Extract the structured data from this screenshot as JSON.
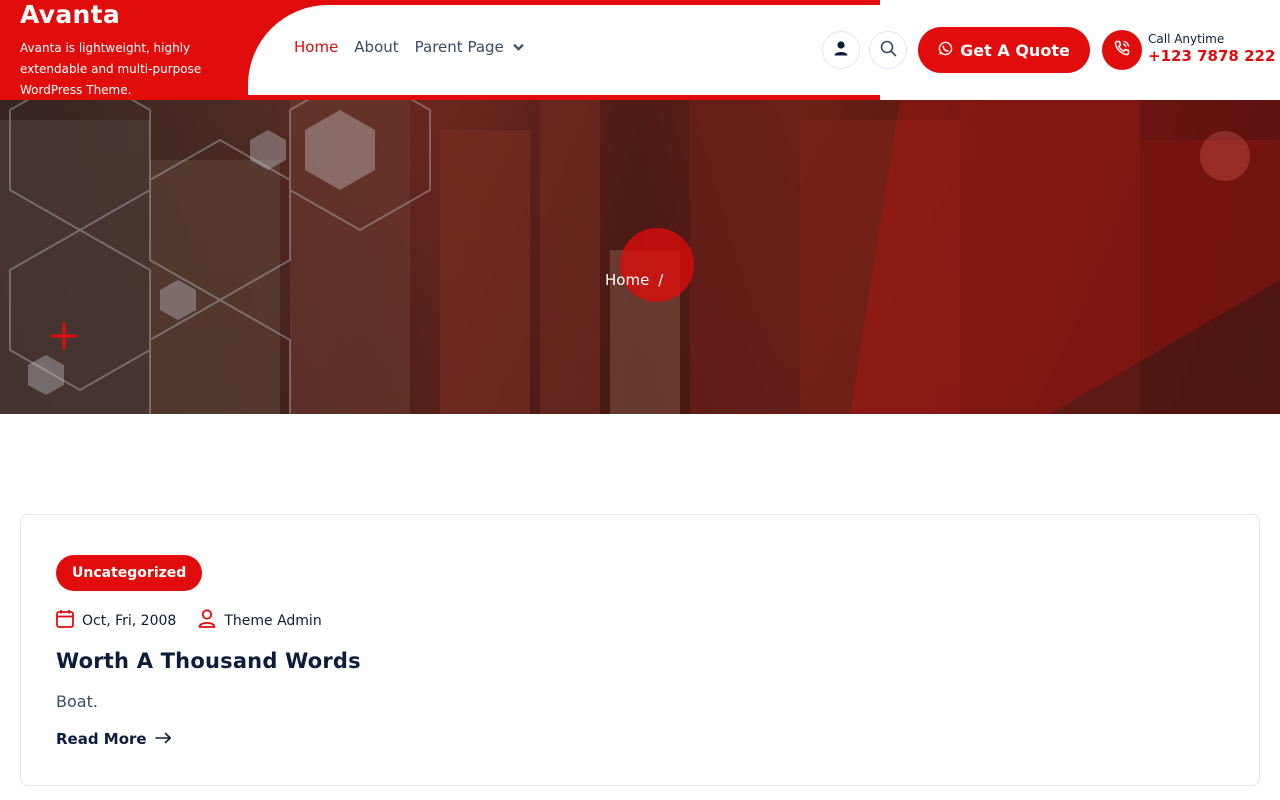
{
  "brand": {
    "title": "Avanta",
    "tagline": "Avanta is lightweight, highly extendable and multi-purpose WordPress Theme."
  },
  "nav": {
    "items": [
      {
        "label": "Home",
        "active": true
      },
      {
        "label": "About",
        "active": false
      },
      {
        "label": "Parent Page",
        "active": false,
        "has_dropdown": true
      }
    ]
  },
  "header_actions": {
    "account_icon": "user-icon",
    "search_icon": "search-icon",
    "quote_button": {
      "icon": "whatsapp-icon",
      "label": "Get A Quote"
    },
    "call": {
      "icon": "phone-icon",
      "label": "Call Anytime",
      "number": "+123 7878 222"
    }
  },
  "hero": {
    "breadcrumb": [
      {
        "label": "Home"
      }
    ],
    "separator": "/"
  },
  "post": {
    "category": "Uncategorized",
    "date": "Oct, Fri, 2008",
    "author": "Theme Admin",
    "title": "Worth A Thousand Words",
    "excerpt": "Boat.",
    "read_more": "Read More"
  },
  "colors": {
    "accent": "#e10c0c",
    "heading": "#0b1d3a",
    "text": "#3a4a66"
  }
}
